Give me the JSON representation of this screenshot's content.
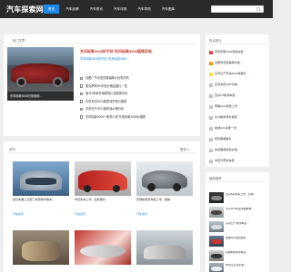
{
  "site": {
    "logo": "汽车探索网"
  },
  "nav": [
    "首页",
    "汽车品牌",
    "汽车资讯",
    "汽车评测",
    "汽车导购",
    "汽车图库"
  ],
  "search": {
    "placeholder": ""
  },
  "hot": {
    "title": "热门文章",
    "hero_caption": "东风标致3008日常使用…",
    "headline": "东风标致3008好不好 东风标致3008值得买吗",
    "subline": "东风标致3008好不好_东风标致3008…",
    "items": [
      "合肥广汽丰田凯美瑞降价优惠详情",
      "雷克萨斯RX车型价格及图片一览",
      "宝马3系新车最新报价及配置详情",
      "东风本田2021款思域车型价格表",
      "东风日产2021款轩逸价格分析",
      "东风标致3008一般多少钱 东风标致3008价格表"
    ]
  },
  "grid": {
    "title": "资讯",
    "more": "更多>>",
    "items": [
      {
        "title": "最近车展上出现了新款豪华跑车，…",
        "tag": "汽车资讯"
      },
      {
        "title": "丰田新车上市，最新报价…",
        "tag": "汽车资讯"
      },
      {
        "title": "奇瑞新能源车型上市，续航…",
        "tag": "汽车资讯"
      },
      {
        "title": "",
        "tag": ""
      },
      {
        "title": "",
        "tag": ""
      },
      {
        "title": "",
        "tag": ""
      }
    ]
  },
  "sidebar": {
    "rank_title": "热点排行",
    "rank": [
      "雷克萨斯2023款新车型",
      "合肥丰田凯美瑞价格…",
      "东风日产轩逸2022款报价…",
      "东风本田CRV价格…",
      "宝马X3新款车型…",
      "奔驰GLC新款上市",
      "大众帕萨特价格表",
      "奥迪A4L车型一览",
      "别克君威报价…",
      "本田雅阁最新价格…",
      "丰田卡罗拉车型…"
    ],
    "rec_title": "最新推荐",
    "rec": [
      "宝马5系新车上市，价格…",
      "大众ID.4车型详细参数…",
      "东风日产新款车型…",
      "奥迪A6L最新报价…",
      "奔驰E级新款车型…",
      "丰田汉兰达价格…"
    ]
  }
}
